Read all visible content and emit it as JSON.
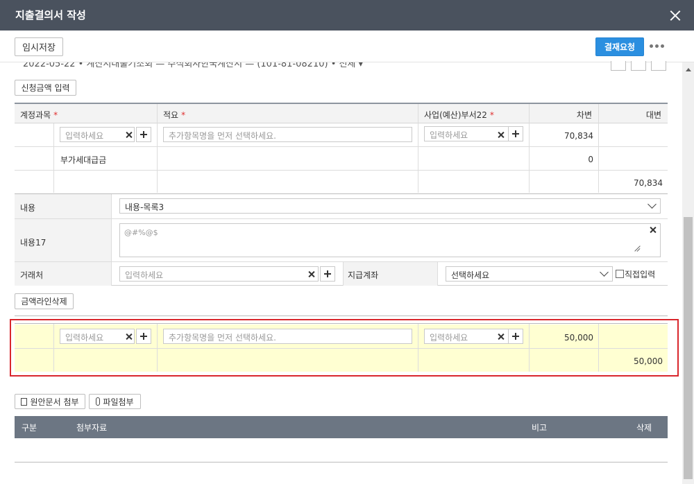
{
  "window": {
    "title": "지출결의서 작성"
  },
  "toolbar": {
    "temp_save": "임시저장",
    "approve": "결재요청"
  },
  "cut_row": {
    "text": "2022-05-22 • 계산서대출기조회 — 주식회사한국계산서 — (101-81-08210) • 전체 ▾"
  },
  "buttons": {
    "request_amount": "신청금액 입력",
    "delete_amount_line": "금액라인삭제",
    "attach_document": "원안문서 첨부",
    "attach_file": "파일첨부"
  },
  "grid": {
    "headers": {
      "account": "계정과목",
      "summary": "적요",
      "department": "사업(예산)부서22",
      "debit": "차변",
      "credit": "대변"
    },
    "required_mark": "*",
    "rows": [
      {
        "account_placeholder": "입력하세요",
        "summary_placeholder": "추가항목명을 먼저 선택하세요.",
        "department_placeholder": "입력하세요",
        "debit": "70,834",
        "credit": ""
      },
      {
        "account": "부가세대급금",
        "debit": "0",
        "credit": ""
      },
      {
        "credit": "70,834"
      }
    ]
  },
  "form": {
    "content_label": "내용",
    "content_value": "내용-목록3",
    "content17_label": "내용17",
    "content17_value": "@#%@$",
    "vendor_label": "거래처",
    "vendor_placeholder": "입력하세요",
    "account_label": "지급계좌",
    "account_value": "선택하세요",
    "direct_input": "직접입력"
  },
  "highlight_grid": {
    "rows": [
      {
        "account_placeholder": "입력하세요",
        "summary_placeholder": "추가항목명을 먼저 선택하세요.",
        "department_placeholder": "입력하세요",
        "debit": "50,000"
      },
      {
        "credit": "50,000"
      }
    ]
  },
  "attachments": {
    "headers": {
      "type": "구분",
      "file": "첨부자료",
      "note": "비고",
      "delete": "삭제"
    }
  },
  "colors": {
    "titlebar": "#4a525e",
    "approve": "#2b8fe0",
    "highlight_border": "#d9262c",
    "highlight_fill": "#ffffd2",
    "required": "#e03030"
  }
}
